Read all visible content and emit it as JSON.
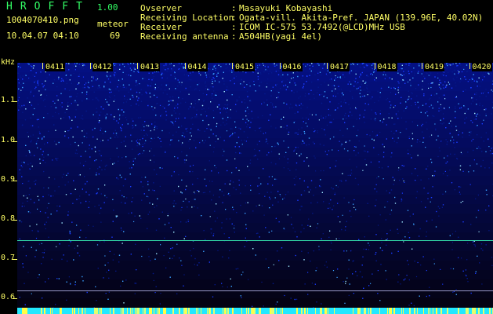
{
  "header": {
    "brand": "HROFFT",
    "version": "1.00",
    "filename": "1004070410.png",
    "meteor_label": "meteor",
    "datetime": "10.04.07 04:10",
    "meteor_count": "69",
    "info": [
      {
        "key": "Ovserver",
        "value": "Masayuki Kobayashi"
      },
      {
        "key": "Receiving Location",
        "value": "Ogata-vill. Akita-Pref. JAPAN (139.96E, 40.02N)"
      },
      {
        "key": "Receiver",
        "value": "ICOM IC-575 53.7492(@LCD)MHz USB"
      },
      {
        "key": "Receiving antenna",
        "value": "A504HB(yagi 4el)"
      }
    ]
  },
  "axis": {
    "unit": "kHz",
    "y_ticks": [
      "1.1",
      "1.0",
      "0.9",
      "0.8",
      "0.7",
      "0.6"
    ],
    "x_ticks": [
      "0411",
      "0412",
      "0413",
      "0414",
      "0415",
      "0416",
      "0417",
      "0418",
      "0419",
      "0420"
    ]
  },
  "colors": {
    "text": "#ffff66",
    "title": "#33ff66",
    "noise_high": "#1a3cff",
    "noise_low": "#061a8c",
    "trace": "#33ddaa",
    "baseline": "#9999cc",
    "bottom_band": "#22e8ff"
  }
}
